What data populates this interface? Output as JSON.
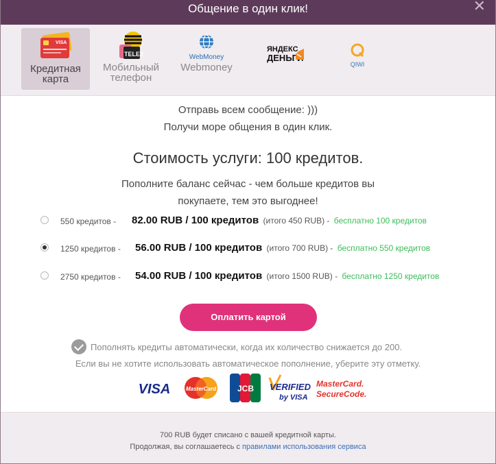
{
  "dialog": {
    "title": "Общение в один клик!",
    "close_glyph": "✕"
  },
  "tabs": [
    {
      "label_line1": "Кредитная",
      "label_line2": "карта",
      "icon": "credit-card-icon",
      "active": true
    },
    {
      "label_line1": "Мобильный",
      "label_line2": "телефон",
      "icon": "tele2-icon",
      "active": false
    },
    {
      "label_line1": "Webmoney",
      "label_line2": "",
      "icon": "webmoney-icon",
      "active": false
    },
    {
      "label_line1": "",
      "label_line2": "",
      "icon": "yandex-money-icon",
      "active": false
    },
    {
      "label_line1": "",
      "label_line2": "",
      "icon": "qiwi-icon",
      "active": false
    }
  ],
  "tab_logo_text": {
    "card": "VISA",
    "tele2": "TELE2",
    "webmoney": "WebMoney",
    "yandex_line1": "ЯНДЕКС",
    "yandex_line2": "ДЕНЬГИ",
    "qiwi": "QIWI"
  },
  "message": {
    "line1": "Отправь всем сообщение: )))",
    "line2": "Получи море общения в один клик."
  },
  "price": {
    "title": "Стоимость услуги: 100 кредитов.",
    "promo_line1": "Пополните баланс сейчас - чем больше кредитов вы",
    "promo_line2": "покупаете, тем это выгоднее!"
  },
  "options": [
    {
      "credits": "550 кредитов -",
      "price": "82.00 RUB / 100 кредитов",
      "total": "(итого 450 RUB) -",
      "bonus": "бесплатно 100 кредитов",
      "selected": false
    },
    {
      "credits": "1250 кредитов -",
      "price": "56.00 RUB / 100 кредитов",
      "total": "(итого 700 RUB) -",
      "bonus": "бесплатно 550 кредитов",
      "selected": true
    },
    {
      "credits": "2750 кредитов -",
      "price": "54.00 RUB / 100 кредитов",
      "total": "(итого 1500 RUB) -",
      "bonus": "бесплатно 1250 кредитов",
      "selected": false
    }
  ],
  "pay_button": "Оплатить картой",
  "auto_refill": {
    "checked": true,
    "label": "Пополнять кредиты автоматически, когда их количество снижается до 200.",
    "note": "Если вы не хотите использовать автоматическое пополнение, уберите эту отметку."
  },
  "card_logos": {
    "visa": "VISA",
    "mastercard": "MasterCard",
    "jcb": "JCB",
    "verified_line1": "VERIFIED",
    "verified_line2": "by VISA",
    "securecode_line1": "MasterCard.",
    "securecode_line2": "SecureCode."
  },
  "footer": {
    "line1": "700 RUB будет списано с вашей кредитной карты.",
    "line2_prefix": "Продолжая, вы соглашаетесь с",
    "terms_link": "правилами использования сервиса"
  },
  "colors": {
    "title_bar": "#5e3a5a",
    "pay_button": "#e0327a",
    "bonus_text": "#3bbd5a",
    "link": "#3a6fb7"
  }
}
